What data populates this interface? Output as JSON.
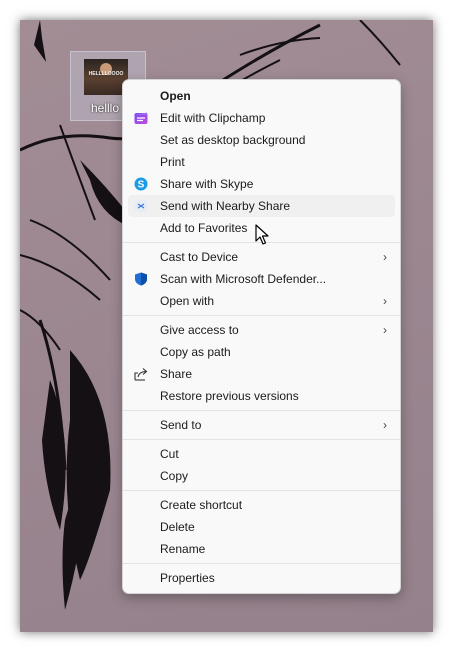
{
  "desktop": {
    "icon": {
      "thumbnail_text": "HELLLLOOOO",
      "label": "helllo"
    }
  },
  "menu": {
    "groups": [
      [
        {
          "label": "Open",
          "bold": true
        },
        {
          "label": "Edit with Clipchamp",
          "icon": "clipchamp-icon"
        },
        {
          "label": "Set as desktop background"
        },
        {
          "label": "Print"
        },
        {
          "label": "Share with Skype",
          "icon": "skype-icon"
        },
        {
          "label": "Send with Nearby Share",
          "icon": "nearby-share-icon",
          "highlighted": true
        },
        {
          "label": "Add to Favorites"
        }
      ],
      [
        {
          "label": "Cast to Device",
          "submenu": true
        },
        {
          "label": "Scan with Microsoft Defender...",
          "icon": "defender-shield-icon"
        },
        {
          "label": "Open with",
          "submenu": true
        }
      ],
      [
        {
          "label": "Give access to",
          "submenu": true
        },
        {
          "label": "Copy as path"
        },
        {
          "label": "Share",
          "icon": "share-icon"
        },
        {
          "label": "Restore previous versions"
        }
      ],
      [
        {
          "label": "Send to",
          "submenu": true
        }
      ],
      [
        {
          "label": "Cut"
        },
        {
          "label": "Copy"
        }
      ],
      [
        {
          "label": "Create shortcut"
        },
        {
          "label": "Delete"
        },
        {
          "label": "Rename"
        }
      ],
      [
        {
          "label": "Properties"
        }
      ]
    ],
    "submenu_glyph": "›"
  }
}
